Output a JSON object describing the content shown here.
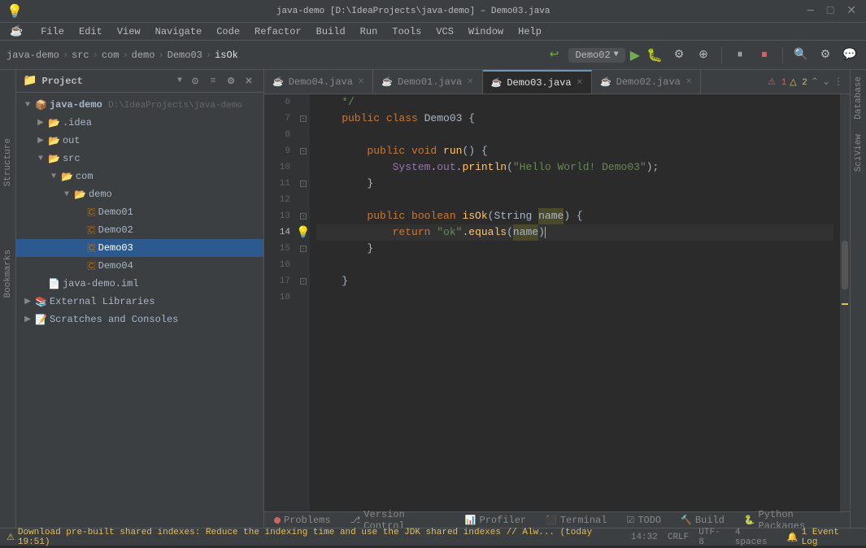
{
  "titlebar": {
    "title": "java-demo [D:\\IdeaProjects\\java-demo] – Demo03.java"
  },
  "menubar": {
    "items": [
      "File",
      "Edit",
      "View",
      "Navigate",
      "Code",
      "Refactor",
      "Build",
      "Run",
      "Tools",
      "VCS",
      "Window",
      "Help"
    ]
  },
  "breadcrumb": {
    "items": [
      "java-demo",
      "src",
      "com",
      "demo",
      "Demo03",
      "isOk"
    ]
  },
  "runconfig": {
    "name": "Demo02"
  },
  "projectpanel": {
    "title": "Project",
    "tree": [
      {
        "id": "java-demo",
        "label": "java-demo",
        "subtitle": "D:\\IdeaProjects\\java-demo",
        "type": "project",
        "indent": 0,
        "expanded": true
      },
      {
        "id": "out",
        "label": "out",
        "type": "folder",
        "indent": 1,
        "expanded": false
      },
      {
        "id": "src",
        "label": "src",
        "type": "folder-src",
        "indent": 1,
        "expanded": true
      },
      {
        "id": "com",
        "label": "com",
        "type": "folder",
        "indent": 2,
        "expanded": true
      },
      {
        "id": "demo",
        "label": "demo",
        "type": "folder",
        "indent": 3,
        "expanded": true
      },
      {
        "id": "Demo01",
        "label": "Demo01",
        "type": "java",
        "indent": 4
      },
      {
        "id": "Demo02",
        "label": "Demo02",
        "type": "java",
        "indent": 4
      },
      {
        "id": "Demo03",
        "label": "Demo03",
        "type": "java",
        "indent": 4,
        "selected": true
      },
      {
        "id": "Demo04",
        "label": "Demo04",
        "type": "java",
        "indent": 4
      },
      {
        "id": "java-demo-iml",
        "label": "java-demo.iml",
        "type": "iml",
        "indent": 1
      },
      {
        "id": "ext-libs",
        "label": "External Libraries",
        "type": "ext",
        "indent": 0,
        "expanded": false
      },
      {
        "id": "scratches",
        "label": "Scratches and Consoles",
        "type": "scratches",
        "indent": 0,
        "expanded": false
      }
    ]
  },
  "tabs": [
    {
      "id": "demo04",
      "label": "Demo04.java",
      "active": false
    },
    {
      "id": "demo01",
      "label": "Demo01.java",
      "active": false
    },
    {
      "id": "demo03",
      "label": "Demo03.java",
      "active": true
    },
    {
      "id": "demo02",
      "label": "Demo02.java",
      "active": false
    }
  ],
  "editor": {
    "error_count": "1",
    "warning_count": "2",
    "lines": [
      {
        "num": 6,
        "content_type": "comment",
        "text": "    */"
      },
      {
        "num": 7,
        "content_type": "code",
        "text": "    public class Demo03 {"
      },
      {
        "num": 8,
        "content_type": "empty"
      },
      {
        "num": 9,
        "content_type": "code",
        "text": "        public void run() {"
      },
      {
        "num": 10,
        "content_type": "code",
        "text": "            System.out.println(\"Hello World! Demo03\");"
      },
      {
        "num": 11,
        "content_type": "code",
        "text": "        }"
      },
      {
        "num": 12,
        "content_type": "empty"
      },
      {
        "num": 13,
        "content_type": "code",
        "text": "        public boolean isOk(String name) {"
      },
      {
        "num": 14,
        "content_type": "code",
        "text": "            return \"ok\".equals(name)"
      },
      {
        "num": 15,
        "content_type": "code",
        "text": "        }"
      },
      {
        "num": 16,
        "content_type": "empty"
      },
      {
        "num": 17,
        "content_type": "code",
        "text": "    }"
      },
      {
        "num": 18,
        "content_type": "empty"
      }
    ]
  },
  "bottomtabs": {
    "items": [
      {
        "id": "problems",
        "label": "Problems",
        "icon": "dot-red"
      },
      {
        "id": "vcs",
        "label": "Version Control",
        "icon": "vcs"
      },
      {
        "id": "profiler",
        "label": "Profiler",
        "icon": "profiler"
      },
      {
        "id": "terminal",
        "label": "Terminal",
        "icon": "terminal"
      },
      {
        "id": "todo",
        "label": "TODO",
        "icon": "todo"
      },
      {
        "id": "build",
        "label": "Build",
        "icon": "build"
      },
      {
        "id": "python",
        "label": "Python Packages",
        "icon": "python"
      }
    ]
  },
  "statusbar": {
    "message": "Download pre-built shared indexes: Reduce the indexing time and use the JDK shared indexes // Alw... (today 19:51)",
    "position": "14:32",
    "encoding_lf": "CRLF",
    "encoding": "UTF-8",
    "indent": "4 spaces",
    "event_log": "1 Event Log"
  },
  "rightsidebar": {
    "panels": [
      "Database",
      "SciView"
    ]
  },
  "leftsidebar": {
    "panels": [
      "Structure",
      "Bookmarks"
    ]
  }
}
